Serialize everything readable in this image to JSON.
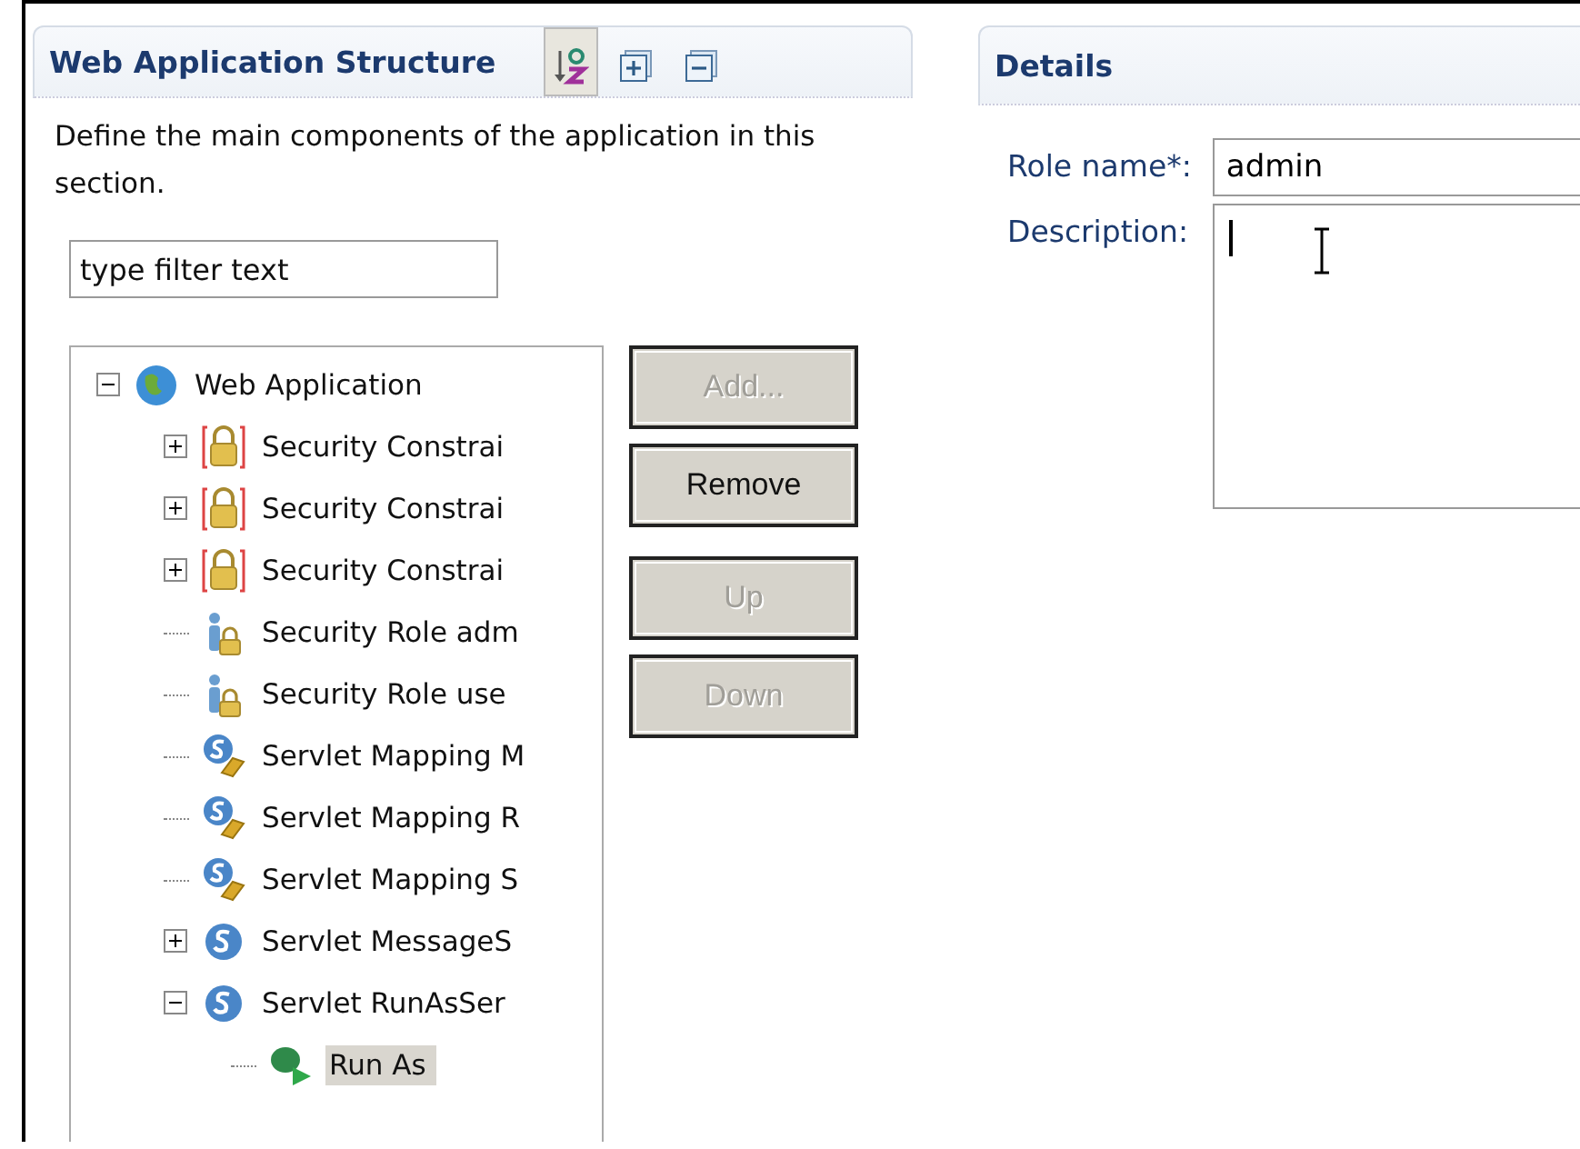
{
  "structure": {
    "title": "Web Application Structure",
    "tools": [
      {
        "kind": "sort",
        "selected": true
      },
      {
        "kind": "expand",
        "selected": false
      },
      {
        "kind": "collapse",
        "selected": false
      }
    ],
    "description": "Define the main components of the application in this section.",
    "filter": {
      "placeholder": "type filter text"
    },
    "tree": [
      {
        "label": "Web Application",
        "kind": "globe",
        "expanded": true,
        "selected": false,
        "children": [
          {
            "label": "Security Constrai",
            "kind": "lock",
            "expanded": false,
            "selected": false
          },
          {
            "label": "Security Constrai",
            "kind": "lock",
            "expanded": false,
            "selected": false
          },
          {
            "label": "Security Constrai",
            "kind": "lock",
            "expanded": false,
            "selected": false
          },
          {
            "label": "Security Role adm",
            "kind": "role",
            "selected": false
          },
          {
            "label": "Security Role use",
            "kind": "role",
            "selected": false
          },
          {
            "label": "Servlet Mapping M",
            "kind": "mapping",
            "selected": false
          },
          {
            "label": "Servlet Mapping R",
            "kind": "mapping",
            "selected": false
          },
          {
            "label": "Servlet Mapping S",
            "kind": "mapping",
            "selected": false
          },
          {
            "label": "Servlet MessageS",
            "kind": "servlet",
            "expanded": false,
            "selected": false
          },
          {
            "label": "Servlet RunAsSer",
            "kind": "servlet",
            "expanded": true,
            "selected": false,
            "children": [
              {
                "label": "Run As",
                "kind": "runas",
                "selected": true
              }
            ]
          }
        ]
      }
    ],
    "buttons": [
      {
        "label": "Add...",
        "disabled": true
      },
      {
        "label": "Remove",
        "disabled": false
      },
      {
        "label": "Up",
        "disabled": true
      },
      {
        "label": "Down",
        "disabled": true
      }
    ]
  },
  "details": {
    "title": "Details",
    "fields": [
      {
        "label": "Role name*:",
        "value": "admin",
        "kind": "line"
      },
      {
        "label": "Description:",
        "kind": "area"
      }
    ]
  }
}
